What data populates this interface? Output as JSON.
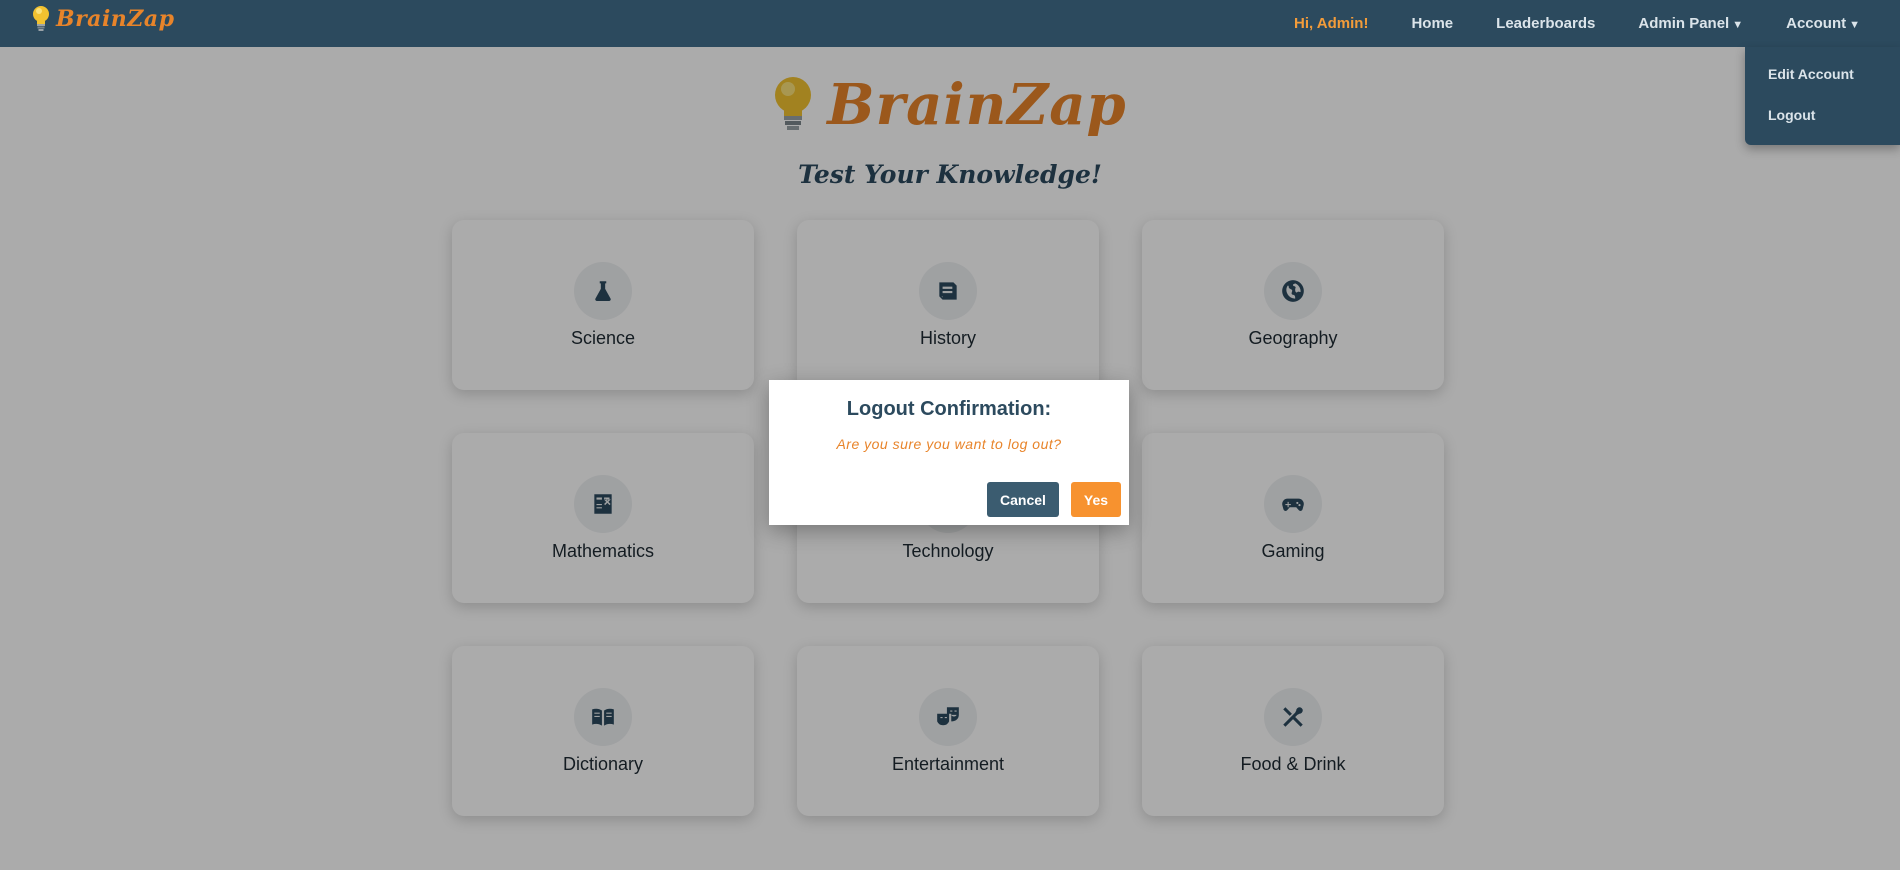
{
  "brand": {
    "name": "BrainZap"
  },
  "nav": {
    "greeting": "Hi, Admin!",
    "home": "Home",
    "leaderboards": "Leaderboards",
    "admin_panel": "Admin Panel",
    "account": "Account",
    "caret": "▼"
  },
  "account_menu": {
    "items": [
      {
        "label": "Edit Account"
      },
      {
        "label": "Logout"
      }
    ]
  },
  "hero": {
    "logo_text": "BrainZap",
    "tagline": "Test Your Knowledge!"
  },
  "categories": [
    {
      "label": "Science",
      "icon": "flask-icon"
    },
    {
      "label": "History",
      "icon": "scroll-icon"
    },
    {
      "label": "Geography",
      "icon": "globe-icon"
    },
    {
      "label": "Mathematics",
      "icon": "calculator-icon"
    },
    {
      "label": "Technology",
      "icon": "computer-icon"
    },
    {
      "label": "Gaming",
      "icon": "gamepad-icon"
    },
    {
      "label": "Dictionary",
      "icon": "book-icon"
    },
    {
      "label": "Entertainment",
      "icon": "masks-icon"
    },
    {
      "label": "Food & Drink",
      "icon": "utensils-icon"
    }
  ],
  "modal": {
    "title": "Logout Confirmation:",
    "message": "Are you sure you want to log out?",
    "cancel_label": "Cancel",
    "confirm_label": "Yes"
  },
  "colors": {
    "navbar": "#2c4a5e",
    "accent_orange": "#e8842a",
    "button_cancel": "#3b5c70",
    "button_yes": "#f7922f"
  }
}
